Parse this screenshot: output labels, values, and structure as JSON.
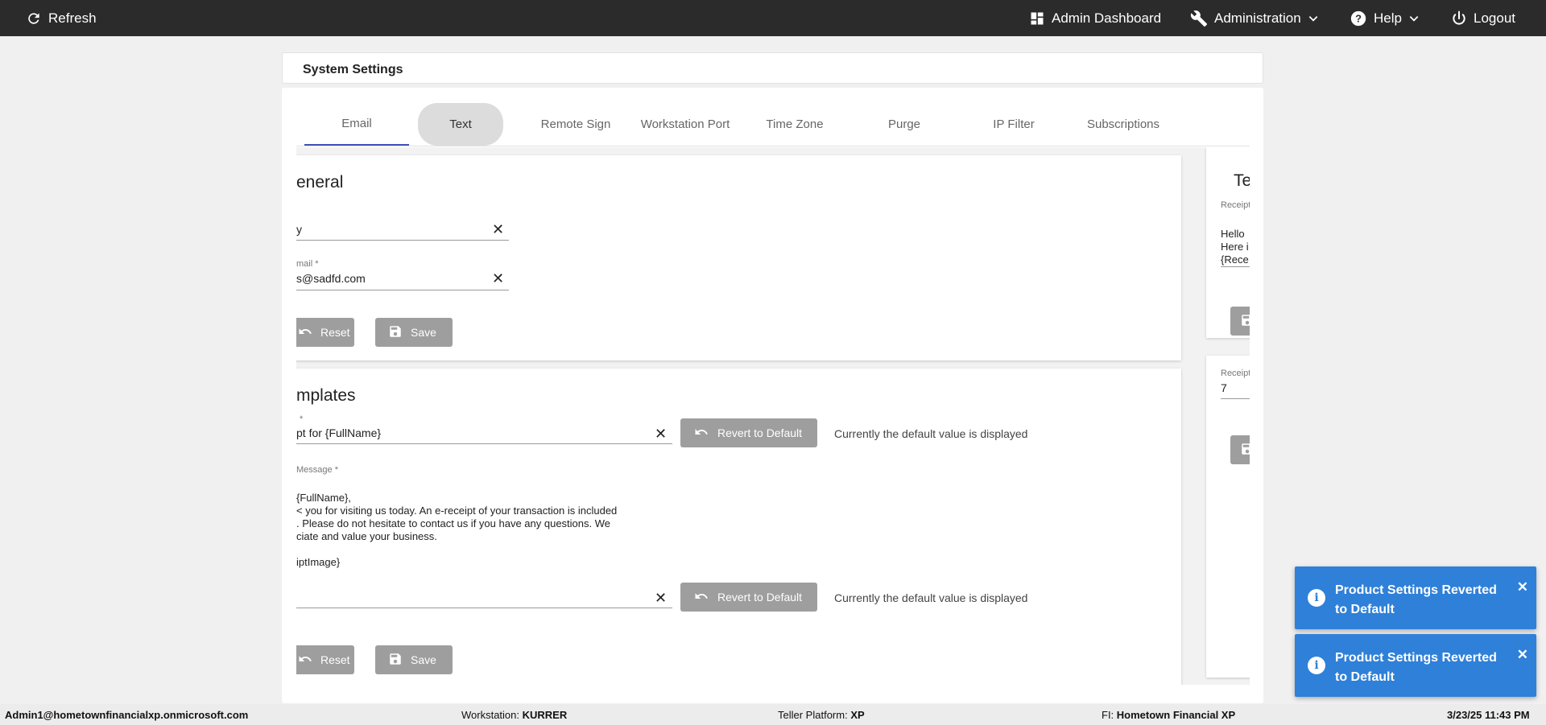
{
  "topbar": {
    "refresh": "Refresh",
    "admin_dashboard": "Admin Dashboard",
    "administration": "Administration",
    "help": "Help",
    "logout": "Logout",
    "bg_color": "#2b2b2b"
  },
  "page": {
    "title": "System Settings"
  },
  "tabs": [
    "Email",
    "Text",
    "Remote Sign",
    "Workstation Port",
    "Time Zone",
    "Purge",
    "IP Filter",
    "Subscriptions"
  ],
  "general": {
    "heading": "eneral",
    "field1_value": "y",
    "field2_label": "mail *",
    "field2_value": "s@sadfd.com",
    "reset": "Reset",
    "save": "Save"
  },
  "templates": {
    "heading": "mplates",
    "subject_label": "*",
    "subject_value": "pt for {FullName}",
    "revert": "Revert to Default",
    "default_note": "Currently the default value is displayed",
    "message_label": " Message *",
    "message_lines": [
      "{FullName},",
      "< you for visiting us today. An e-receipt of your transaction is included",
      ". Please do not hesitate to contact us if you have any questions. We",
      "ciate and value your business.",
      "",
      "iptImage}"
    ],
    "field3_value": "",
    "revert2": "Revert to Default",
    "default_note2": "Currently the default value is displayed",
    "reset": "Reset",
    "save": "Save"
  },
  "right_panel": {
    "heading": "Te",
    "label1": "Receipt",
    "text_lines": [
      "Hello",
      "Here i",
      "{Rece"
    ],
    "label2": "Receipt",
    "value2": "7"
  },
  "footer": {
    "user": "Admin1@hometownfinancialxp.onmicrosoft.com",
    "workstation_label": "Workstation: ",
    "workstation": "KURRER",
    "teller_label": "Teller Platform: ",
    "teller": "XP",
    "fi_label": "FI: ",
    "fi": "Hometown Financial XP",
    "datetime": "3/23/25 11:43 PM"
  },
  "toasts": [
    {
      "message": "Product Settings Reverted to Default"
    },
    {
      "message": "Product Settings Reverted to Default"
    }
  ],
  "colors": {
    "tab_indicator": "#3f51b5",
    "toast": "#2f80d8",
    "button": "#9e9e9e"
  }
}
